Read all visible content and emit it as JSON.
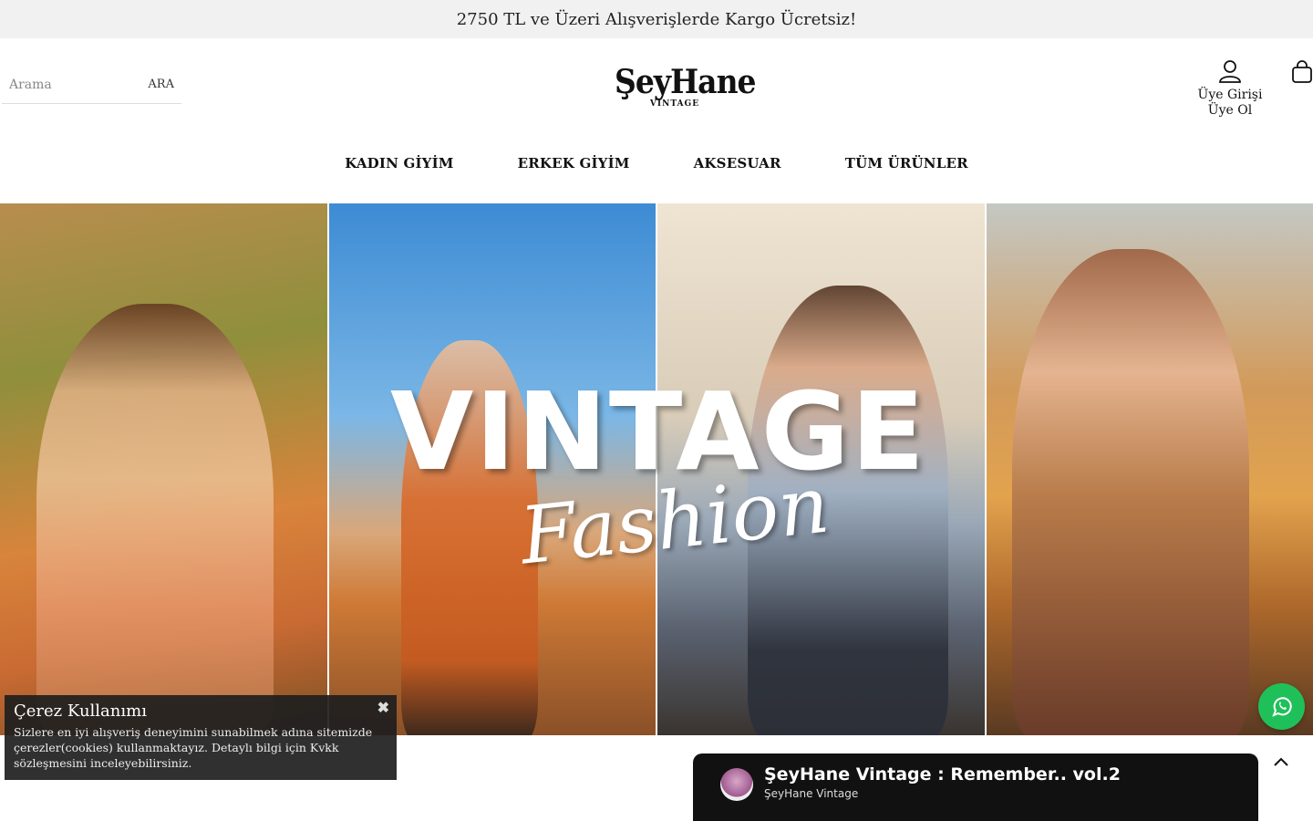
{
  "announcement": "2750 TL ve Üzeri Alışverişlerde Kargo Ücretsiz!",
  "search": {
    "placeholder": "Arama",
    "button": "ARA"
  },
  "logo": {
    "main": "ŞeyHane",
    "sub": "VINTAGE"
  },
  "account": {
    "login": "Üye Girişi",
    "register": "Üye Ol",
    "icon": "user-icon"
  },
  "cart": {
    "icon": "shopping-bag-icon"
  },
  "nav": [
    "KADIN GİYİM",
    "ERKEK GİYİM",
    "AKSESUAR",
    "TÜM ÜRÜNLER"
  ],
  "hero": {
    "headline": "VINTAGE",
    "script": "Fashion"
  },
  "cookie": {
    "title": "Çerez Kullanımı",
    "text": "Sizlere en iyi alışveriş deneyimini sunabilmek adına sitemizde çerezler(cookies) kullanmaktayız. Detaylı bilgi için Kvkk sözleşmesini inceleyebilirsiniz.",
    "close_icon": "close-icon"
  },
  "video": {
    "title": "ŞeyHane Vintage : Remember.. vol.2",
    "channel": "ŞeyHane Vintage"
  },
  "colors": {
    "announce_bg": "#f1f1f1",
    "whatsapp": "#1fc05a",
    "cookie_bg": "#1e1e1e"
  }
}
